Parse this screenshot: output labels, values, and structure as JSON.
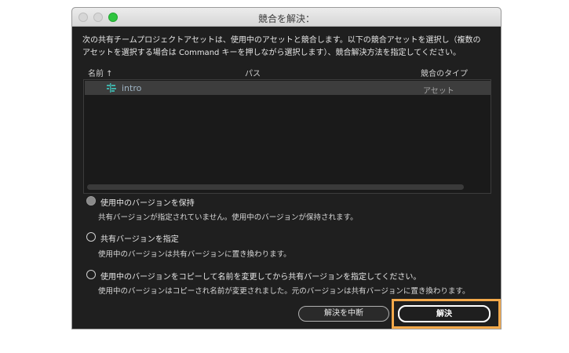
{
  "window": {
    "title": "競合を解決："
  },
  "instructions": {
    "line1": "次の共有チームプロジェクトアセットは、使用中のアセットと競合します。以下の競合アセットを選択し（複数の",
    "line2": "アセットを選択する場合は Command キーを押しながら選択します）、競合解決方法を指定してください。"
  },
  "table": {
    "headers": {
      "name": "名前 ↑",
      "path": "パス",
      "type": "競合のタイプ"
    },
    "rows": [
      {
        "name": "intro",
        "path": "",
        "type": "アセット",
        "icon": "sequence-icon"
      }
    ]
  },
  "options": [
    {
      "label": "使用中のバージョンを保持",
      "description": "共有バージョンが指定されていません。使用中のバージョンが保持されます。",
      "selected": true
    },
    {
      "label": "共有バージョンを指定",
      "description": "使用中のバージョンは共有バージョンに置き換わります。",
      "selected": false
    },
    {
      "label": "使用中のバージョンをコピーして名前を変更してから共有バージョンを指定してください。",
      "description": "使用中のバージョンはコピーされ名前が変更されました。元のバージョンは共有バージョンに置き換わります。",
      "selected": false
    }
  ],
  "buttons": {
    "cancel": "解決を中断",
    "resolve": "解決"
  },
  "colors": {
    "highlight": "#f4a94a",
    "dialog_bg": "#1f1f1f",
    "selected_row": "#3d3d3d",
    "maximize": "#2fc53f"
  }
}
